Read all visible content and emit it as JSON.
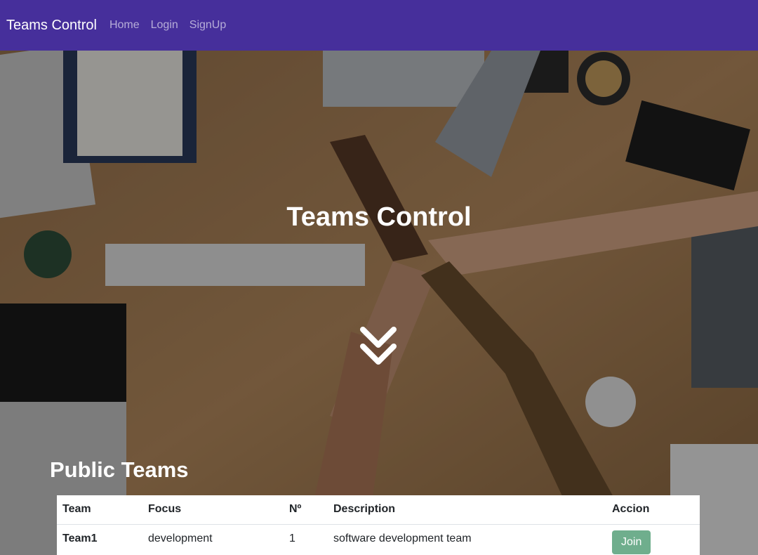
{
  "navbar": {
    "brand": "Teams Control",
    "links": [
      "Home",
      "Login",
      "SignUp"
    ]
  },
  "hero": {
    "title": "Teams Control",
    "scroll_icon": "double-chevron-down-icon"
  },
  "public_teams": {
    "title": "Public Teams",
    "columns": [
      "Team",
      "Focus",
      "Nº",
      "Description",
      "Accion"
    ],
    "rows": [
      {
        "team": "Team1",
        "focus": "development",
        "number": "1",
        "description": "software development team",
        "action": "Join"
      }
    ]
  },
  "colors": {
    "navbar": "#462f9b",
    "join_button": "#6fae8d"
  }
}
